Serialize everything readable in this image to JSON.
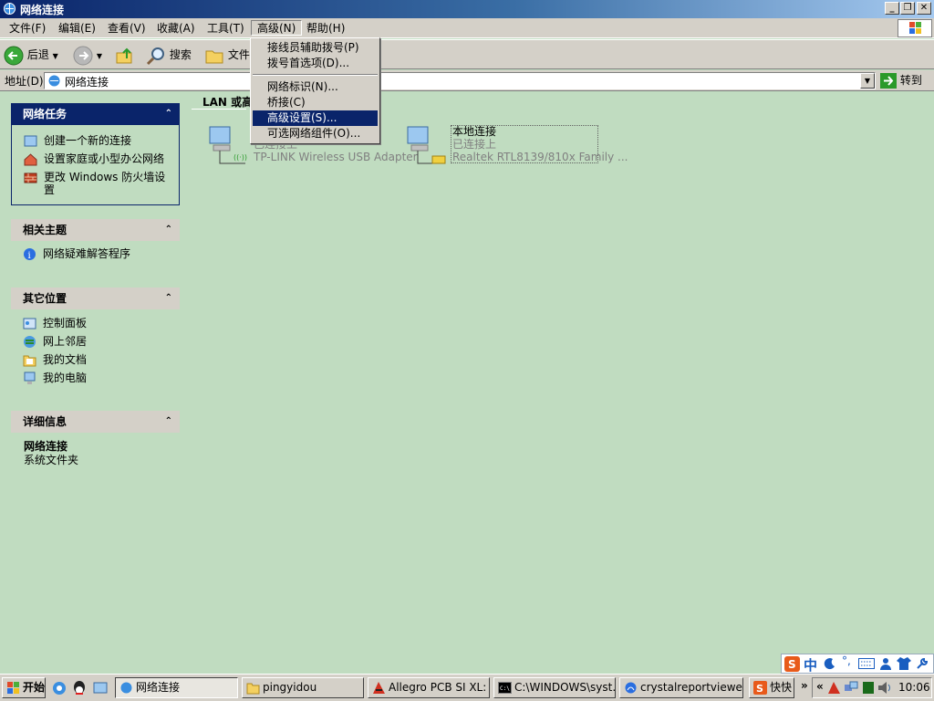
{
  "window": {
    "title": "网络连接",
    "min": "_",
    "max": "❐",
    "close": "✕"
  },
  "menubar": [
    {
      "label": "文件(F)"
    },
    {
      "label": "编辑(E)"
    },
    {
      "label": "查看(V)"
    },
    {
      "label": "收藏(A)"
    },
    {
      "label": "工具(T)"
    },
    {
      "label": "高级(N)"
    },
    {
      "label": "帮助(H)"
    }
  ],
  "toolbar": {
    "back": "后退",
    "search": "搜索",
    "folders": "文件"
  },
  "address": {
    "label": "地址(D)",
    "value": "网络连接",
    "go": "转到"
  },
  "dropdown_menu": [
    {
      "label": "接线员辅助拨号(P)"
    },
    {
      "label": "拨号首选项(D)..."
    },
    {
      "label": "网络标识(N)..."
    },
    {
      "label": "桥接(C)"
    },
    {
      "label": "高级设置(S)..."
    },
    {
      "label": "可选网络组件(O)..."
    }
  ],
  "panels": {
    "network_tasks": {
      "title": "网络任务",
      "items": [
        {
          "label": "创建一个新的连接"
        },
        {
          "label": "设置家庭或小型办公网络"
        },
        {
          "label": "更改 Windows 防火墙设"
        },
        {
          "label": "置"
        }
      ]
    },
    "related": {
      "title": "相关主题",
      "items": [
        {
          "label": "网络疑难解答程序"
        }
      ]
    },
    "other_places": {
      "title": "其它位置",
      "items": [
        {
          "label": "控制面板"
        },
        {
          "label": "网上邻居"
        },
        {
          "label": "我的文档"
        },
        {
          "label": "我的电脑"
        }
      ]
    },
    "details": {
      "title": "详细信息",
      "name": "网络连接",
      "type": "系统文件夹"
    }
  },
  "content": {
    "group_header": "LAN 或高",
    "connections": [
      {
        "name": "",
        "status": "已连接上",
        "device": "TP-LINK Wireless USB Adapter"
      },
      {
        "name": "本地连接",
        "status": "已连接上",
        "device": "Realtek RTL8139/810x Family ..."
      }
    ]
  },
  "taskbar": {
    "start": "开始",
    "buttons": [
      {
        "label": "网络连接"
      },
      {
        "label": "pingyidou"
      },
      {
        "label": "Allegro PCB SI XL: u..."
      },
      {
        "label": "C:\\WINDOWS\\syst..."
      },
      {
        "label": "crystalreportviewer..."
      },
      {
        "label": "快快"
      }
    ],
    "overflow": "»",
    "clock": "10:06",
    "tray_chevron": "«"
  },
  "ime": {
    "label": "中"
  },
  "colors": {
    "accent": "#0a246a",
    "content_bg": "#c0dcc0",
    "chrome": "#d4d0c8"
  }
}
